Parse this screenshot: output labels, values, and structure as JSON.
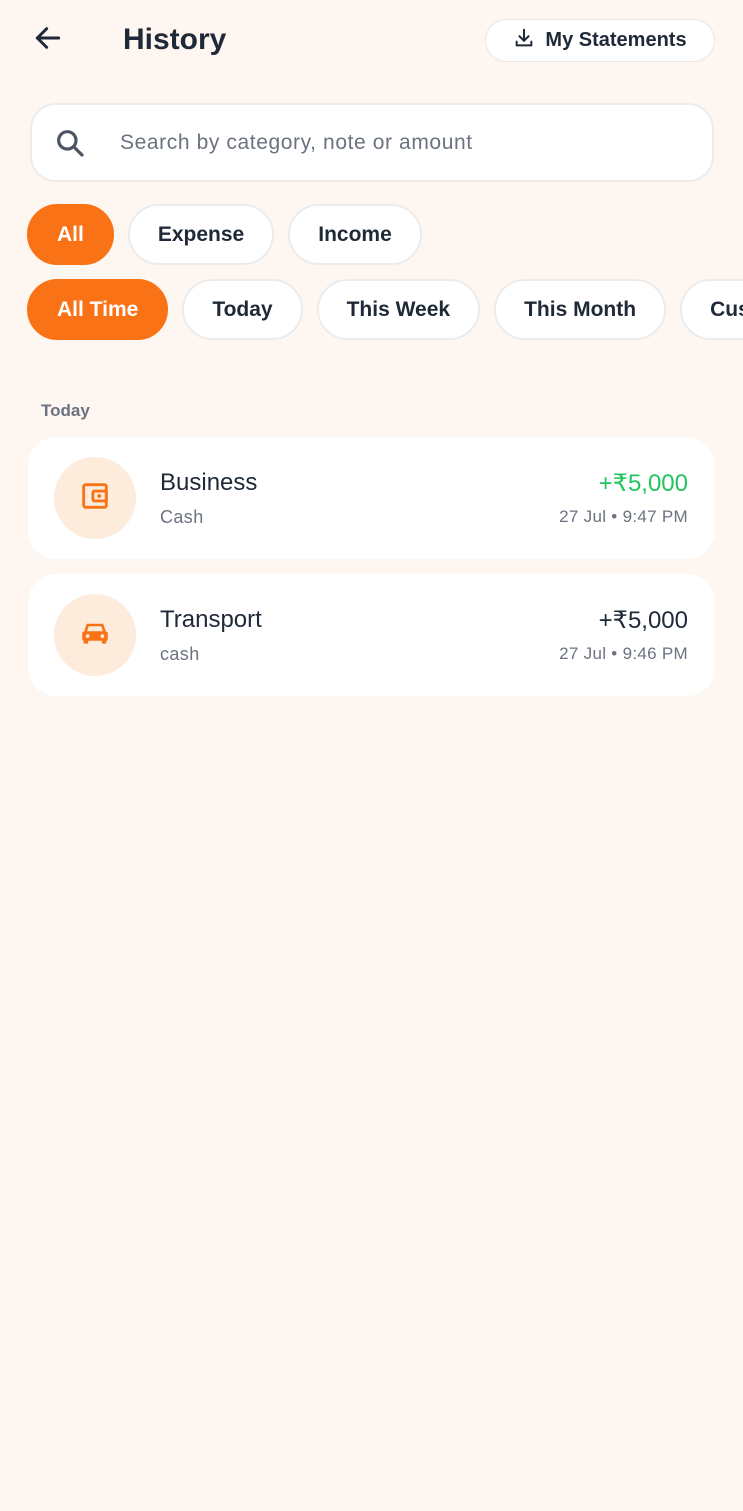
{
  "header": {
    "title": "History",
    "back_icon": "arrow-left-icon",
    "statements_label": "My Statements",
    "statements_icon": "download-icon"
  },
  "search": {
    "placeholder": "Search by category, note or amount",
    "value": "",
    "icon": "search-icon"
  },
  "type_filters": [
    {
      "label": "All",
      "active": true
    },
    {
      "label": "Expense",
      "active": false
    },
    {
      "label": "Income",
      "active": false
    }
  ],
  "time_filters": [
    {
      "label": "All Time",
      "active": true
    },
    {
      "label": "Today",
      "active": false
    },
    {
      "label": "This Week",
      "active": false
    },
    {
      "label": "This Month",
      "active": false
    },
    {
      "label": "Custom",
      "active": false
    }
  ],
  "sections": [
    {
      "label": "Today",
      "transactions": [
        {
          "category": "Business",
          "account": "Cash",
          "amount": "+₹5,000",
          "datetime": "27 Jul • 9:47 PM",
          "icon": "wallet-icon",
          "amount_color": "#22C55E"
        },
        {
          "category": "Transport",
          "account": "cash",
          "amount": "+₹5,000",
          "datetime": "27 Jul • 9:46 PM",
          "icon": "car-icon",
          "amount_color": "#1F2937"
        }
      ]
    }
  ],
  "colors": {
    "accent": "#F97316",
    "background": "#FEF6F0",
    "icon_bg": "#FDEBDC",
    "income_green": "#22C55E",
    "text_dark": "#1F2937",
    "text_muted": "#6B7280"
  }
}
